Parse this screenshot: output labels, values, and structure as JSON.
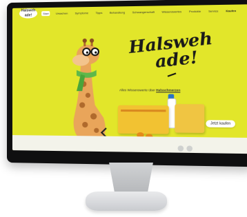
{
  "site": {
    "logo_line1": "Halsweh",
    "logo_line2": "ade!",
    "nav": [
      "Start",
      "Ursachen",
      "Symptome",
      "Tipps",
      "Behandlung",
      "Schwangerschaft",
      "Wissenswertes",
      "Produkte",
      "Service",
      "Kaufen"
    ]
  },
  "hero": {
    "headline_line1": "Halsweh",
    "headline_line2": "ade!",
    "subline_prefix": "Alles Wissenswerte über",
    "subline_link": "Halsschmerzen",
    "cta_label": "Jetzt kaufen"
  },
  "colors": {
    "background": "#e2e62a",
    "product": "#f2c232"
  }
}
